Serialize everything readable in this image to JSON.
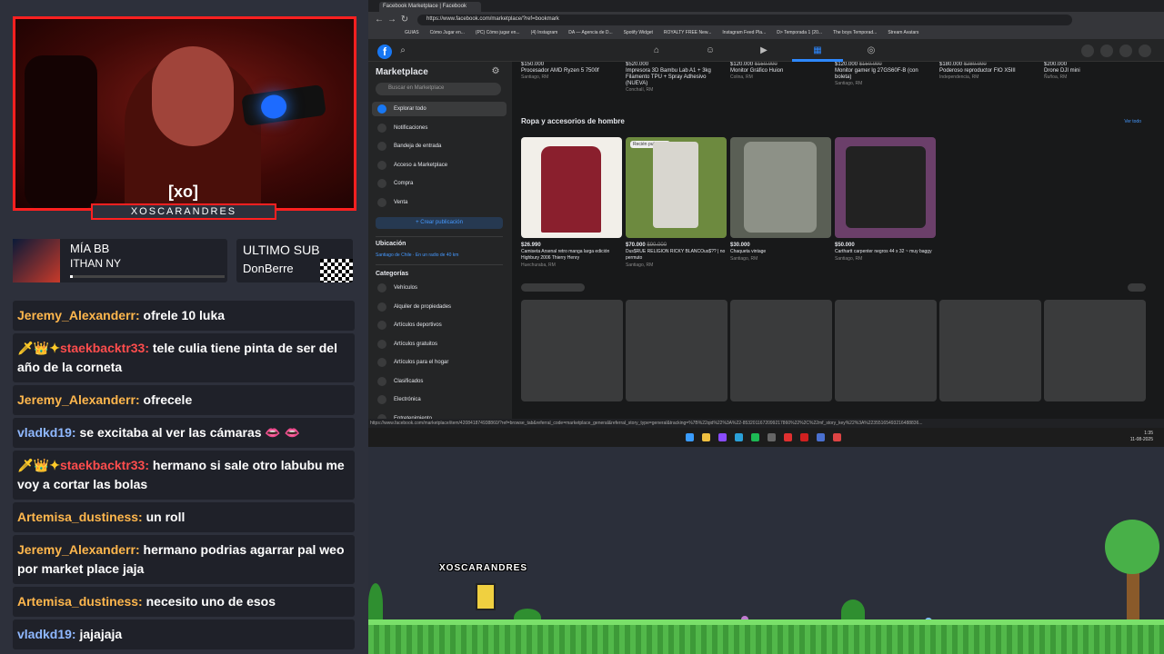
{
  "webcam": {
    "logo": "[xo]",
    "name": "XOSCARANDRES"
  },
  "music": {
    "title": "MÍA BB",
    "artist": "ITHAN NY",
    "progress": 0.02
  },
  "last_sub": {
    "label": "ULTIMO SUB",
    "name": "DonBerre"
  },
  "chat": [
    {
      "user": "Jeremy_Alexanderr:",
      "color": "#ffb74d",
      "badges": "",
      "text": "ofrele 10 luka"
    },
    {
      "user": "staekbacktr33:",
      "color": "#ff4d4d",
      "badges": "🗡👑✦",
      "text": "tele culia tiene pinta de ser del año de la corneta"
    },
    {
      "user": "Jeremy_Alexanderr:",
      "color": "#ffb74d",
      "badges": "",
      "text": "ofrecele"
    },
    {
      "user": "vladkd19:",
      "color": "#8fb8ff",
      "badges": "",
      "text": "se excitaba al ver las cámaras 👄 👄"
    },
    {
      "user": "staekbacktr33:",
      "color": "#ff4d4d",
      "badges": "🗡👑✦",
      "text": "hermano si sale otro labubu me voy a cortar las bolas"
    },
    {
      "user": "Artemisa_dustiness:",
      "color": "#ffb74d",
      "badges": "",
      "text": "un roll"
    },
    {
      "user": "Jeremy_Alexanderr:",
      "color": "#ffb74d",
      "badges": "",
      "text": "hermano podrias agarrar pal weo por market place jaja"
    },
    {
      "user": "Artemisa_dustiness:",
      "color": "#ffb74d",
      "badges": "",
      "text": "necesito uno de esos"
    },
    {
      "user": "vladkd19:",
      "color": "#8fb8ff",
      "badges": "",
      "text": "jajajaja"
    }
  ],
  "browser": {
    "tab_title": "Facebook Marketplace | Facebook",
    "url": "https://www.facebook.com/marketplace/?ref=bookmark",
    "bookmarks": [
      "GUIAS",
      "Cómo Jugar en...",
      "(PC) Cómo jugar en...",
      "(4) Instagram",
      "DA — Agencia de D...",
      "Spotify Widget",
      "ROYALTY FREE New...",
      "Instagram Feed Pla...",
      "D> Temporada 1 (20...",
      "The boys Temporad...",
      "Stream Avatars"
    ],
    "status_url": "https://www.facebook.com/marketplace/item/420841874938860/?ref=browse_tab&referral_code=marketplace_general&referral_story_type=general&tracking=%7B%22qid%22%3A%22-8532011672099217860%22%2C%22mf_story_key%22%3A%22355165493216488836..."
  },
  "sidebar": {
    "title": "Marketplace",
    "search_placeholder": "Buscar en Marketplace",
    "items": [
      "Explorar todo",
      "Notificaciones",
      "Bandeja de entrada",
      "Acceso a Marketplace",
      "Compra",
      "Venta"
    ],
    "create_button": "+ Crear publicación",
    "location_heading": "Ubicación",
    "location": "Santiago de Chile · En un radio de 40 km",
    "categories_heading": "Categorías",
    "categories": [
      "Vehículos",
      "Alquiler de propiedades",
      "Artículos deportivos",
      "Artículos gratuitos",
      "Artículos para el hogar",
      "Clasificados",
      "Electrónica",
      "Entretenimiento"
    ]
  },
  "top_listings": [
    {
      "price": "$150.000",
      "title": "Procesador AMD Ryzen 5 7500f",
      "loc": "Santiago, RM"
    },
    {
      "price": "$520.000",
      "title": "Impresora 3D Bambu Lab A1 + 3kg Filamento TPU + Spray Adhesivo (NUEVA)",
      "loc": "Conchalí, RM"
    },
    {
      "price": "$120.000",
      "old": "$150.000",
      "title": "Monitor Gráfico Huion",
      "loc": "Colina, RM"
    },
    {
      "price": "$120.000",
      "old": "$150.000",
      "title": "Monitor gamer lg 27GS60F-B (con boleta)",
      "loc": "Santiago, RM"
    },
    {
      "price": "$180.000",
      "old": "$280.000",
      "title": "Poderoso reproductor FIO X5III",
      "loc": "Independencia, RM"
    },
    {
      "price": "$200.000",
      "title": "Drone DJI mini",
      "loc": "Ñuñoa, RM"
    }
  ],
  "section": {
    "title": "Ropa y accesorios de hombre",
    "see_all": "Ver todo"
  },
  "cards": [
    {
      "price": "$26.990",
      "title": "Camiseta Arsenal retro manga larga edición Highbury 2006 Thierry Henry",
      "loc": "Huechuraba, RM",
      "color": "#f2efe9"
    },
    {
      "price": "$70.000",
      "old": "$90.000",
      "badge": "Recién publicado",
      "title": "Dus$RUE RELIGION RICKY BLANCOus$?? | no permuto",
      "loc": "Santiago, RM",
      "color": "#6d8a3f"
    },
    {
      "price": "$30.000",
      "title": "Chaqueta vintage",
      "loc": "Santiago, RM",
      "color": "#5a5f55"
    },
    {
      "price": "$50.000",
      "title": "Carthartt carpenter negros 44 x 32 ~ muy baggy",
      "loc": "Santiago, RM",
      "color": "#6b3f6a"
    }
  ],
  "taskbar": {
    "time": "1:35",
    "date": "11-08-2025"
  },
  "game": {
    "player": "XOSCARANDRES"
  }
}
